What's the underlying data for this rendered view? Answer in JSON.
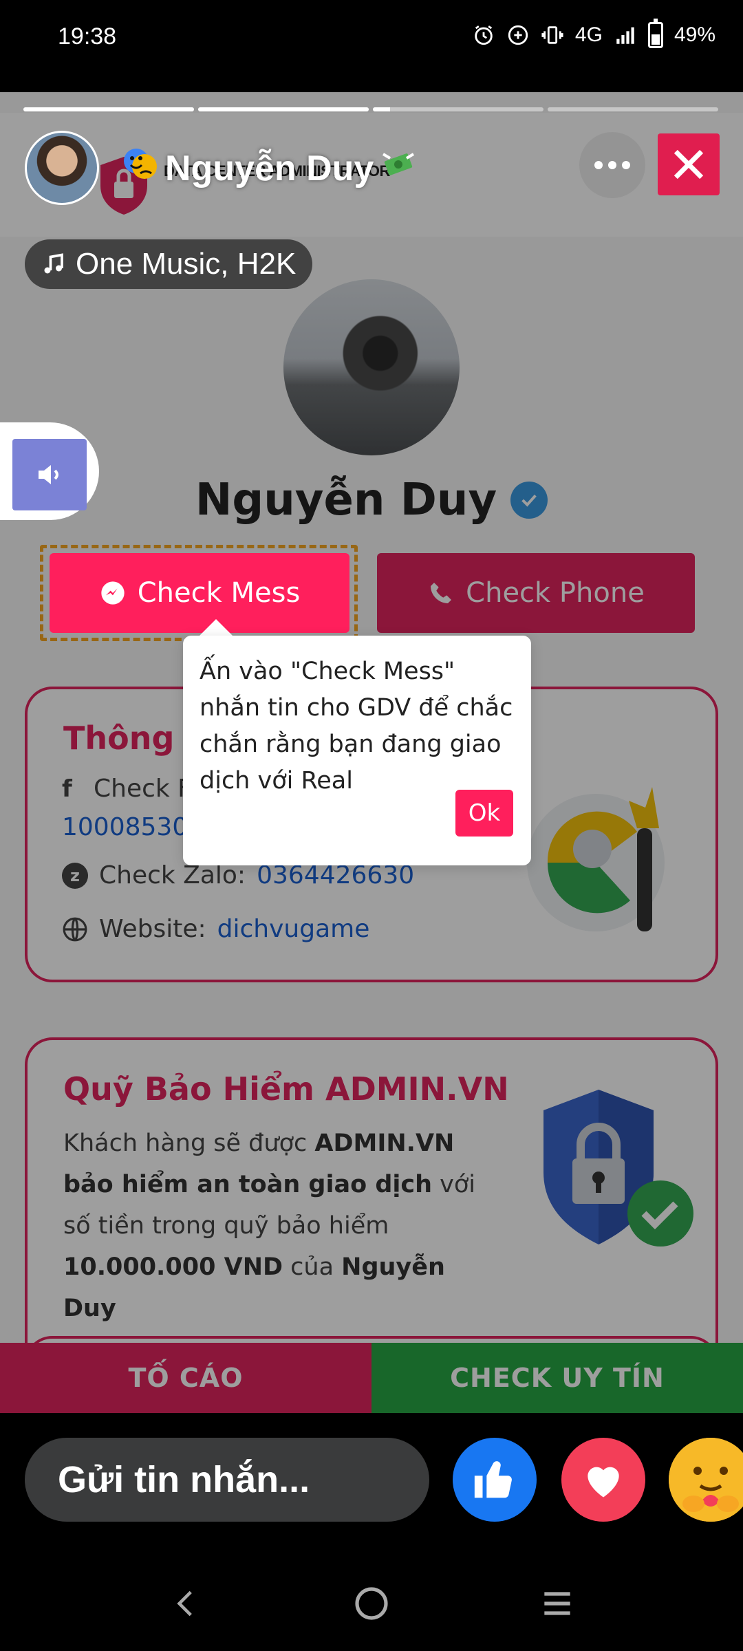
{
  "status_bar": {
    "time": "19:38",
    "network": "4G",
    "battery_percent": "49%",
    "battery_level": 0.49
  },
  "story": {
    "progress": [
      1.0,
      1.0,
      0.1,
      0.0
    ],
    "author_name": "Nguyễn Duy",
    "brand_text": "DATA CENTER ADMINISTRATOR",
    "music": "One Music, H2K"
  },
  "profile": {
    "name": "Nguyễn Duy",
    "check_mess_label": "Check Mess",
    "check_phone_label": "Check Phone"
  },
  "tooltip": {
    "text": "Ấn vào \"Check Mess\" nhắn tin cho GDV để chắc chắn rằng bạn đang giao dịch với Real",
    "ok_label": "Ok"
  },
  "info_card": {
    "title_visible": "Thông ti",
    "facebook_label": "Check F",
    "facebook_value": "10008530",
    "zalo_label": "Check Zalo:",
    "zalo_value": "0364426630",
    "website_label": "Website:",
    "website_value": "dichvugame"
  },
  "insurance_card": {
    "title": "Quỹ Bảo Hiểm ADMIN.VN",
    "text_1": "Khách hàng sẽ được ",
    "bold_1": "ADMIN.VN bảo hiểm an toàn giao dịch",
    "text_2": " với số tiền trong quỹ bảo hiểm ",
    "bold_2": "10.000.000 VND",
    "text_3": " của ",
    "bold_3": "Nguyễn Duy"
  },
  "bottom_buttons": {
    "report": "TỐ CÁO",
    "check": "CHECK UY TÍN"
  },
  "reply": {
    "placeholder": "Gửi tin nhắn..."
  },
  "colors": {
    "accent": "#ff1f5c",
    "brand_red": "#e0245e",
    "green": "#28a745",
    "link": "#1a5fd0"
  }
}
